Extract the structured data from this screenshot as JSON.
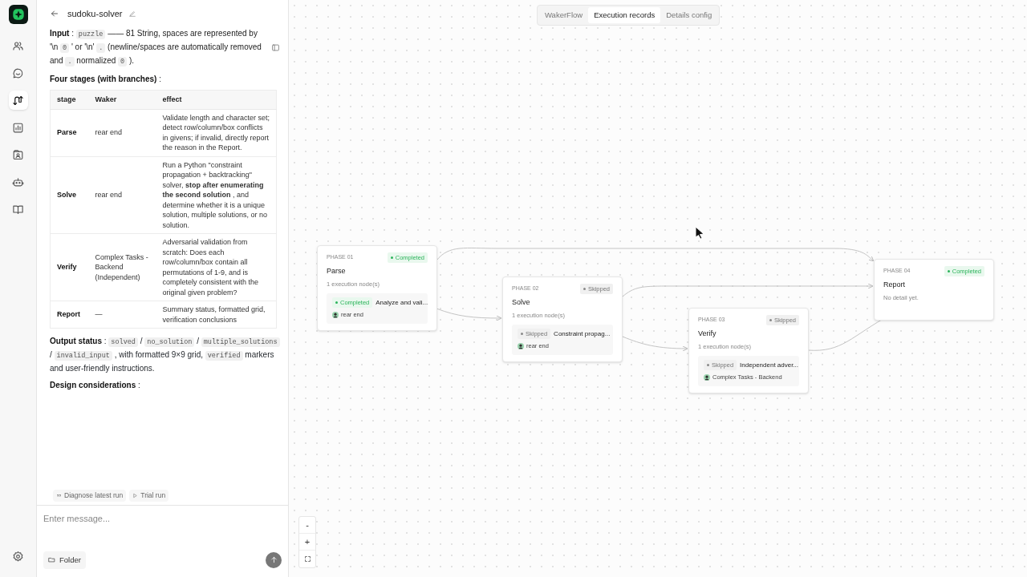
{
  "header": {
    "title": "sudoku-solver"
  },
  "tabs": [
    {
      "label": "WakerFlow",
      "selected": false
    },
    {
      "label": "Execution records",
      "selected": true
    },
    {
      "label": "Details config",
      "selected": false
    }
  ],
  "sidebar": {
    "items": [
      {
        "selected": false
      },
      {
        "selected": false
      },
      {
        "selected": true
      },
      {
        "selected": false
      },
      {
        "selected": false
      },
      {
        "selected": false
      },
      {
        "selected": false
      }
    ]
  },
  "document": {
    "intro": [
      {
        "kind": "bold",
        "text": "Input"
      },
      {
        "kind": "text",
        "text": " : "
      },
      {
        "kind": "code",
        "text": "puzzle"
      },
      {
        "kind": "text",
        "text": " —— 81 String, spaces are represented by '\\n "
      },
      {
        "kind": "code",
        "text": "0"
      },
      {
        "kind": "text",
        "text": " ' or '\\n' "
      },
      {
        "kind": "code",
        "text": "."
      },
      {
        "kind": "text",
        "text": " (newline/spaces are automatically removed and "
      },
      {
        "kind": "code",
        "text": "."
      },
      {
        "kind": "text",
        "text": " normalized "
      },
      {
        "kind": "code",
        "text": "0"
      },
      {
        "kind": "text",
        "text": " )."
      }
    ],
    "stages_heading": [
      {
        "kind": "bold",
        "text": "Four stages (with branches)"
      },
      {
        "kind": "text",
        "text": " :"
      }
    ],
    "table": {
      "columns": [
        "stage",
        "Waker",
        "effect"
      ],
      "rows": [
        [
          "Parse",
          "rear end",
          "Validate length and character set; detect row/column/box conflicts in givens; if invalid, directly report the reason in the Report."
        ],
        [
          "Solve",
          "rear end",
          "Run a Python \"constraint propagation + backtracking\" solver, **stop after enumerating the second solution** , and determine whether it is a unique solution, multiple solutions, or no solution."
        ],
        [
          "Verify",
          "Complex Tasks - Backend (Independent)",
          "Adversarial validation from scratch: Does each row/column/box contain all permutations of 1-9, and is completely consistent with the original given problem?"
        ],
        [
          "Report",
          "—",
          "Summary status, formatted grid, verification conclusions"
        ]
      ]
    },
    "output": [
      {
        "kind": "bold",
        "text": "Output status"
      },
      {
        "kind": "text",
        "text": " : "
      },
      {
        "kind": "code",
        "text": "solved"
      },
      {
        "kind": "text",
        "text": " / "
      },
      {
        "kind": "code",
        "text": "no_solution"
      },
      {
        "kind": "text",
        "text": " / "
      },
      {
        "kind": "code",
        "text": "multiple_solutions"
      },
      {
        "kind": "text",
        "text": " / "
      },
      {
        "kind": "code",
        "text": "invalid_input"
      },
      {
        "kind": "text",
        "text": " , with formatted 9×9 grid, "
      },
      {
        "kind": "code",
        "text": "verified"
      },
      {
        "kind": "text",
        "text": " markers and user-friendly instructions."
      }
    ],
    "design": [
      {
        "kind": "bold",
        "text": "Design considerations"
      },
      {
        "kind": "text",
        "text": " :"
      }
    ]
  },
  "quick_actions": [
    "Diagnose latest run",
    "Trial run"
  ],
  "composer": {
    "placeholder": "Enter message...",
    "folder_button": "Folder"
  },
  "canvas": {
    "zoom_controls": [
      "-",
      "+"
    ],
    "phases": [
      {
        "phase": "PHASE 01",
        "completed": true,
        "status_label": "Completed",
        "title": "Parse",
        "count": "1 execution node(s)",
        "node": {
          "completed": true,
          "status_label": "Completed",
          "text": "Analyze and vali...",
          "owner": "rear end"
        }
      },
      {
        "phase": "PHASE 02",
        "completed": false,
        "status_label": "Skipped",
        "title": "Solve",
        "count": "1 execution node(s)",
        "node": {
          "completed": false,
          "status_label": "Skipped",
          "text": "Constraint propag...",
          "owner": "rear end"
        }
      },
      {
        "phase": "PHASE 03",
        "completed": false,
        "status_label": "Skipped",
        "title": "Verify",
        "count": "1 execution node(s)",
        "node": {
          "completed": false,
          "status_label": "Skipped",
          "text": "Independent adver...",
          "owner": "Complex Tasks - Backend"
        }
      },
      {
        "phase": "PHASE 04",
        "completed": true,
        "status_label": "Completed",
        "title": "Report",
        "detail": "No detail yet."
      }
    ]
  }
}
